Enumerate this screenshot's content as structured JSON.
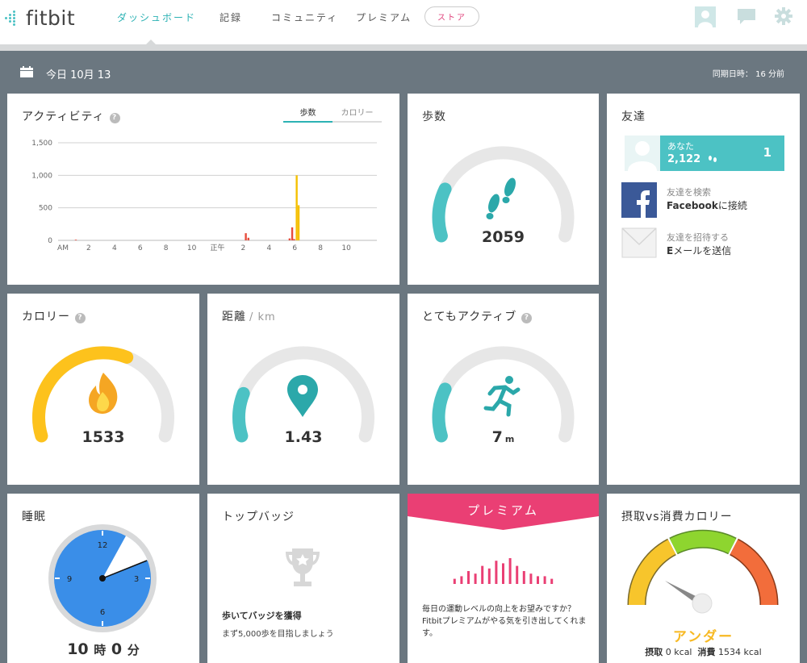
{
  "header": {
    "logo": "fitbit",
    "nav": [
      "ダッシュボード",
      "記録",
      "コミュニティ",
      "プレミアム"
    ],
    "store": "ストア",
    "icons": [
      "profile-icon",
      "messages-icon",
      "settings-icon"
    ]
  },
  "datebar": {
    "date": "今日 10月 13",
    "sync": "同期日時： 16 分前"
  },
  "activity": {
    "title": "アクティビティ",
    "tabs": [
      "歩数",
      "カロリー"
    ],
    "active_tab": "歩数"
  },
  "chart_data": {
    "type": "bar",
    "title": "アクティビティ",
    "y_ticks": [
      "1,500",
      "1,000",
      "500",
      "0"
    ],
    "ylim": [
      0,
      1500
    ],
    "x_ticks": [
      "AM",
      "2",
      "4",
      "6",
      "8",
      "10",
      "正午",
      "2",
      "4",
      "6",
      "8",
      "10"
    ],
    "x": [
      1.0,
      14.2,
      14.4,
      17.6,
      17.8,
      17.95,
      18.15,
      18.3
    ],
    "values": [
      10,
      110,
      40,
      30,
      200,
      20,
      1000,
      540
    ],
    "colors": [
      "#e74c3c",
      "#e74c3c",
      "#e74c3c",
      "#e74c3c",
      "#e74c3c",
      "#e74c3c",
      "#f5c000",
      "#f5c000"
    ],
    "grid": true
  },
  "steps": {
    "title": "歩数",
    "value": "2059",
    "progress": 0.2,
    "icon": "footprints-icon"
  },
  "friends": {
    "title": "友達",
    "me": {
      "name": "あなた",
      "steps": "2,122",
      "rank": "1"
    },
    "facebook": {
      "line1": "友達を検索",
      "line2_bold": "Facebook",
      "line2_rest": "に接続"
    },
    "email": {
      "line1": "友達を招待する",
      "line2_bold": "E",
      "line2_rest": "メールを送信"
    }
  },
  "calories": {
    "title": "カロリー",
    "value": "1533",
    "progress": 0.6,
    "icon": "flame-icon"
  },
  "distance": {
    "title": "距離",
    "unit": "/ km",
    "value": "1.43",
    "progress": 0.18,
    "icon": "location-pin-icon"
  },
  "active": {
    "title": "とてもアクティブ",
    "value": "7",
    "unit": "m",
    "progress": 0.2,
    "icon": "runner-icon"
  },
  "sleep": {
    "title": "睡眠",
    "value_h": "10",
    "h_label": "時",
    "value_m": "0",
    "m_label": "分",
    "clock": [
      "12",
      "3",
      "6",
      "9"
    ],
    "colors": {
      "face": "#3a8ee8",
      "rim": "#d8d9da"
    }
  },
  "badges": {
    "title": "トップバッジ",
    "label": "歩いてバッジを獲得",
    "sub": "まず5,000歩を目指しましょう",
    "icon": "trophy-icon"
  },
  "premium": {
    "title": "プレミアム",
    "text": "毎日の運動レベルの向上をお望みですか？Fitbitプレミアムがやる気を引き出してくれます。",
    "bars": [
      2,
      3,
      5,
      4,
      7,
      6,
      9,
      8,
      10,
      7,
      5,
      4,
      3,
      3,
      2
    ],
    "color": "#ea3f74"
  },
  "intake": {
    "title": "摂取vs消費カロリー",
    "status": "アンダー",
    "intake_label": "摂取",
    "intake_val": "0 kcal",
    "burn_label": "消費",
    "burn_val": "1534 kcal",
    "colors": [
      "#f7c52c",
      "#8ed52f",
      "#f26d3b"
    ]
  },
  "colors": {
    "teal": "#4cc2c4",
    "orange": "#fdc21c",
    "gray_track": "#e7e7e7",
    "status": "#f7b923",
    "accent": "#2cb2b4"
  }
}
